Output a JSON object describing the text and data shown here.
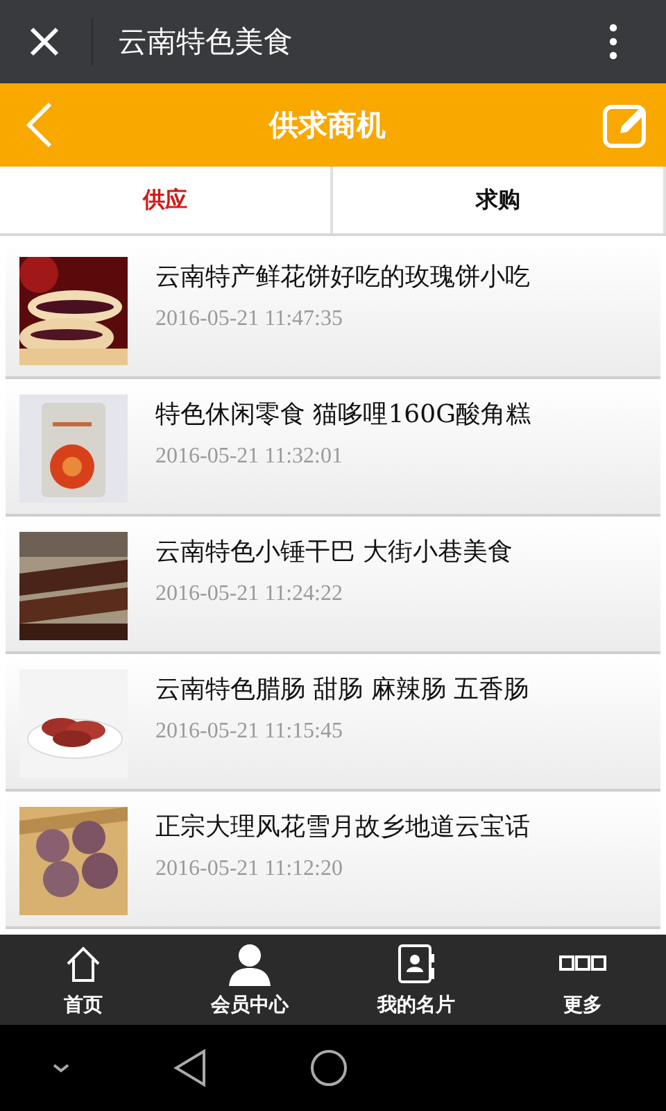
{
  "window": {
    "title": "云南特色美食"
  },
  "header": {
    "title": "供求商机"
  },
  "tabs": [
    {
      "label": "供应",
      "selected": true
    },
    {
      "label": "求购",
      "selected": false
    }
  ],
  "items": [
    {
      "title": "云南特产鲜花饼好吃的玫瑰饼小吃",
      "time": "2016-05-21 11:47:35"
    },
    {
      "title": "特色休闲零食 猫哆哩160G酸角糕",
      "time": "2016-05-21 11:32:01"
    },
    {
      "title": "云南特色小锤干巴 大街小巷美食",
      "time": "2016-05-21 11:24:22"
    },
    {
      "title": "云南特色腊肠 甜肠 麻辣肠 五香肠",
      "time": "2016-05-21 11:15:45"
    },
    {
      "title": "正宗大理风花雪月故乡地道云宝话",
      "time": "2016-05-21 11:12:20"
    }
  ],
  "bottom_nav": [
    {
      "label": "首页",
      "kind": "home"
    },
    {
      "label": "会员中心",
      "kind": "user"
    },
    {
      "label": "我的名片",
      "kind": "card"
    },
    {
      "label": "更多",
      "kind": "more"
    }
  ]
}
